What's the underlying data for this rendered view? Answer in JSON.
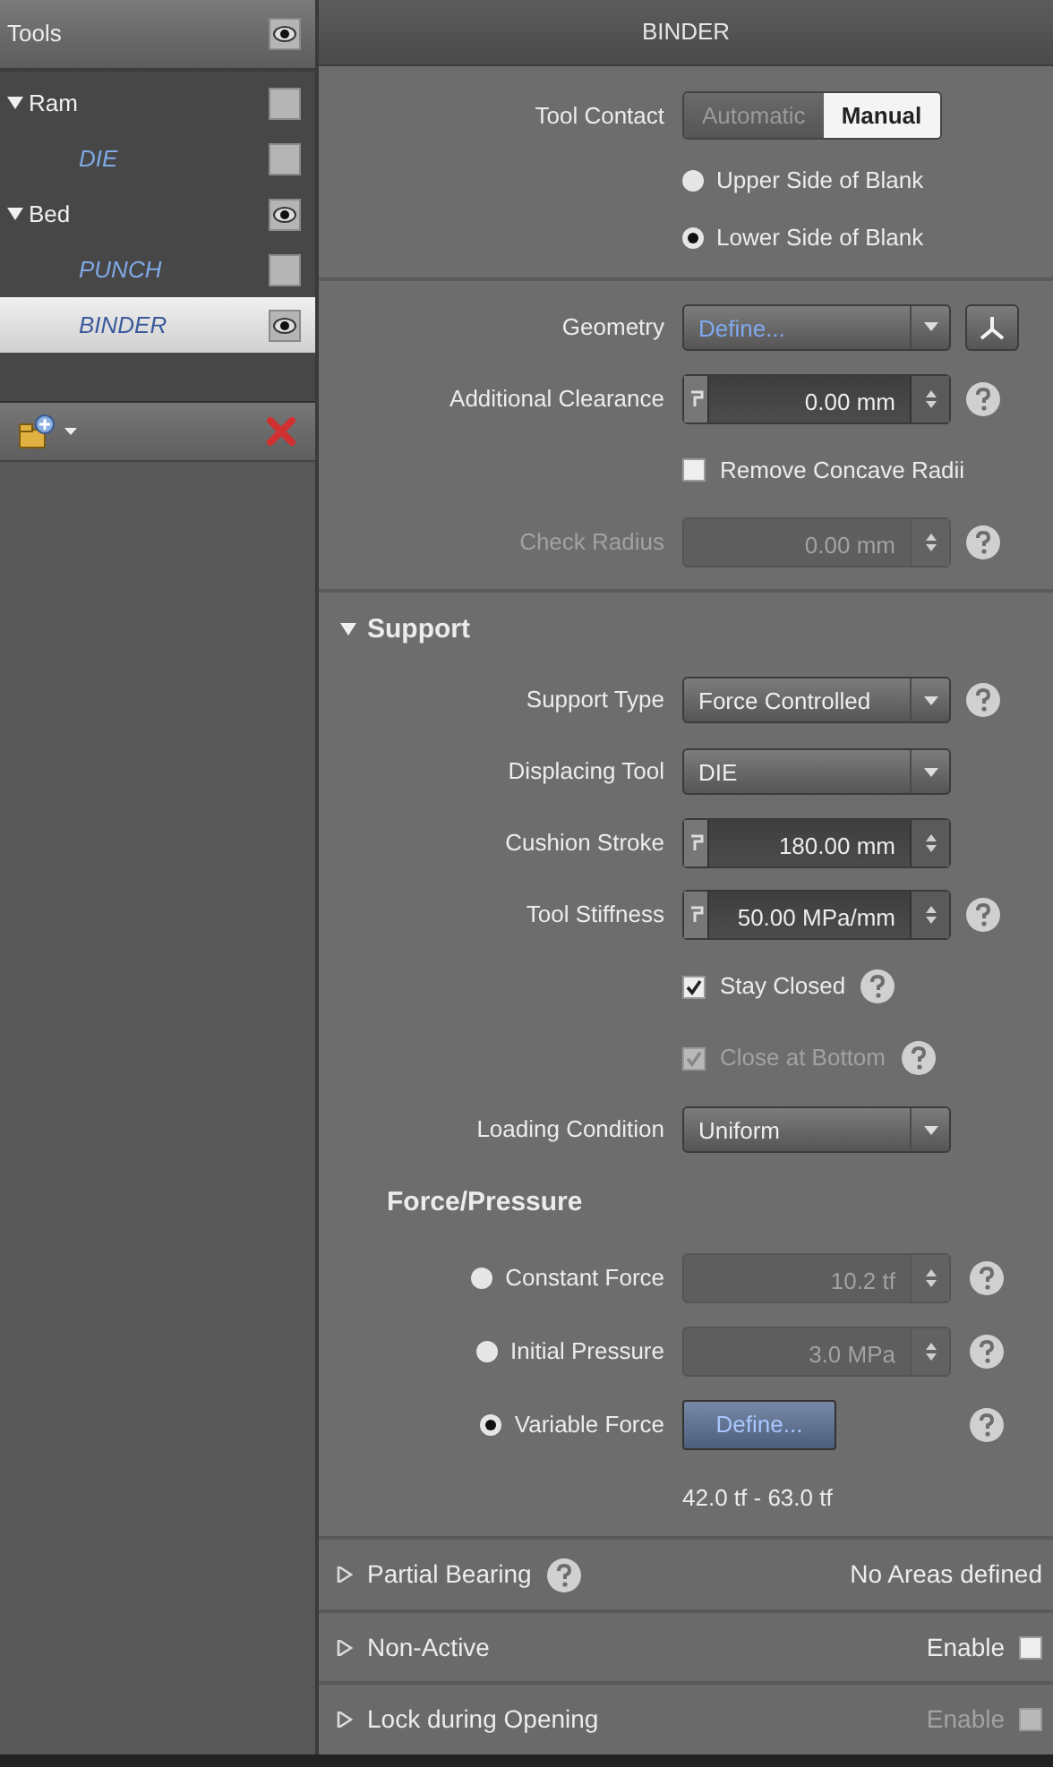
{
  "sidebar": {
    "title": "Tools",
    "visible": true,
    "items": [
      {
        "label": "Ram",
        "kind": "group",
        "expanded": true,
        "visible": false,
        "selected": false,
        "children": [
          {
            "label": "DIE",
            "kind": "tool",
            "visible": false,
            "selected": false
          }
        ]
      },
      {
        "label": "Bed",
        "kind": "group",
        "expanded": true,
        "visible": true,
        "selected": false,
        "children": [
          {
            "label": "PUNCH",
            "kind": "tool",
            "visible": false,
            "selected": false
          },
          {
            "label": "BINDER",
            "kind": "tool",
            "visible": true,
            "selected": true
          }
        ]
      }
    ]
  },
  "panel": {
    "title": "BINDER",
    "tool_contact": {
      "label": "Tool Contact",
      "options": [
        {
          "label": "Automatic",
          "selected": false
        },
        {
          "label": "Manual",
          "selected": true
        }
      ]
    },
    "contact_side": [
      {
        "label": "Upper Side of Blank",
        "selected": false
      },
      {
        "label": "Lower Side of Blank",
        "selected": true
      }
    ],
    "geometry_rows": [
      {
        "kind": "define-dropdown",
        "label": "Geometry",
        "value": "Define..."
      },
      {
        "kind": "spin",
        "label": "Additional Clearance",
        "value": "0.00 mm",
        "disabled": false,
        "help": true
      },
      {
        "kind": "checkbox",
        "label": "Remove Concave Radii",
        "checked": false,
        "disabled": false
      },
      {
        "kind": "spin",
        "label": "Check Radius",
        "value": "0.00 mm",
        "disabled": true,
        "help": true
      }
    ],
    "support": {
      "title": "Support",
      "expanded": true,
      "rows": [
        {
          "kind": "dropdown",
          "label": "Support Type",
          "value": "Force Controlled",
          "help": true
        },
        {
          "kind": "dropdown",
          "label": "Displacing Tool",
          "value": "DIE"
        },
        {
          "kind": "spin",
          "label": "Cushion Stroke",
          "value": "180.00 mm",
          "disabled": false
        },
        {
          "kind": "spin",
          "label": "Tool Stiffness",
          "value": "50.00 MPa/mm",
          "disabled": false,
          "help": true
        },
        {
          "kind": "checkbox",
          "label": "Stay Closed",
          "checked": true,
          "disabled": false,
          "help": true
        },
        {
          "kind": "checkbox",
          "label": "Close at Bottom",
          "checked": true,
          "disabled": true,
          "help": true
        },
        {
          "kind": "dropdown",
          "label": "Loading Condition",
          "value": "Uniform"
        }
      ],
      "force_pressure": {
        "title": "Force/Pressure",
        "options": [
          {
            "label": "Constant Force",
            "selected": false,
            "control": {
              "kind": "spin",
              "value": "10.2 tf",
              "disabled": true
            },
            "help": true
          },
          {
            "label": "Initial Pressure",
            "selected": false,
            "control": {
              "kind": "spin",
              "value": "3.0 MPa",
              "disabled": true
            },
            "help": true
          },
          {
            "label": "Variable Force",
            "selected": true,
            "control": {
              "kind": "button",
              "value": "Define..."
            },
            "help": true
          }
        ],
        "range": "42.0 tf - 63.0 tf"
      }
    },
    "collapsed_sections": [
      {
        "title": "Partial Bearing",
        "expanded": false,
        "help": true,
        "status": "No Areas defined"
      },
      {
        "title": "Non-Active",
        "expanded": false,
        "enable": {
          "label": "Enable",
          "checked": false,
          "disabled": false
        }
      },
      {
        "title": "Lock during Opening",
        "expanded": false,
        "enable": {
          "label": "Enable",
          "checked": false,
          "disabled": true
        }
      }
    ]
  }
}
